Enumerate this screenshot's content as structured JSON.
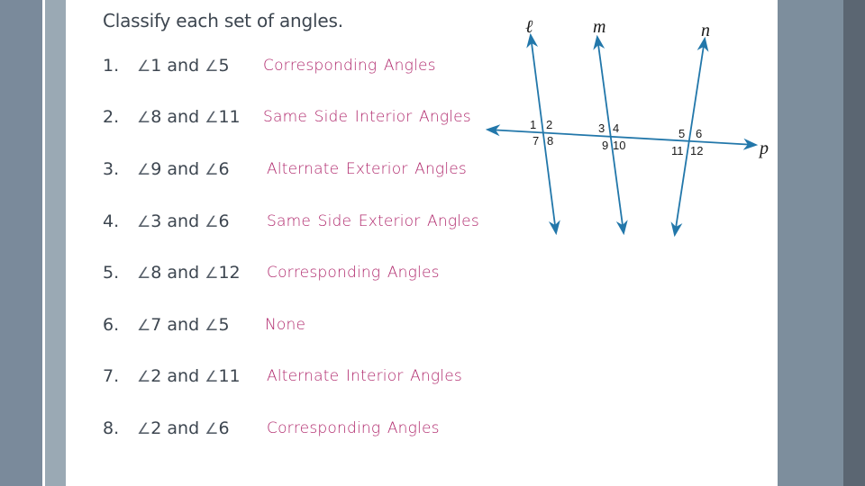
{
  "title": "Classify each set of angles.",
  "angle_symbol": "∠",
  "and_word": "and",
  "items": [
    {
      "num": "1.",
      "a": "1",
      "b": "5",
      "answer": "Corresponding Angles"
    },
    {
      "num": "2.",
      "a": "8",
      "b": "11",
      "answer": "Same Side Interior Angles"
    },
    {
      "num": "3.",
      "a": "9",
      "b": "6",
      "answer": "Alternate Exterior Angles"
    },
    {
      "num": "4.",
      "a": "3",
      "b": "6",
      "answer": "Same Side Exterior Angles"
    },
    {
      "num": "5.",
      "a": "8",
      "b": "12",
      "answer": "Corresponding Angles"
    },
    {
      "num": "6.",
      "a": "7",
      "b": "5",
      "answer": "None"
    },
    {
      "num": "7.",
      "a": "2",
      "b": "11",
      "answer": "Alternate Interior Angles"
    },
    {
      "num": "8.",
      "a": "2",
      "b": "6",
      "answer": "Corresponding Angles"
    }
  ],
  "diagram": {
    "line_labels": {
      "l": "ℓ",
      "m": "m",
      "n": "n",
      "p": "p"
    },
    "angle_numbers": {
      "l": [
        "1",
        "2",
        "7",
        "8"
      ],
      "m": [
        "3",
        "4",
        "9",
        "10"
      ],
      "n": [
        "5",
        "6",
        "11",
        "12"
      ]
    },
    "line_color": "#2277aa"
  },
  "colors": {
    "answer_text": "#b0286c",
    "body_text": "#3d4650"
  }
}
